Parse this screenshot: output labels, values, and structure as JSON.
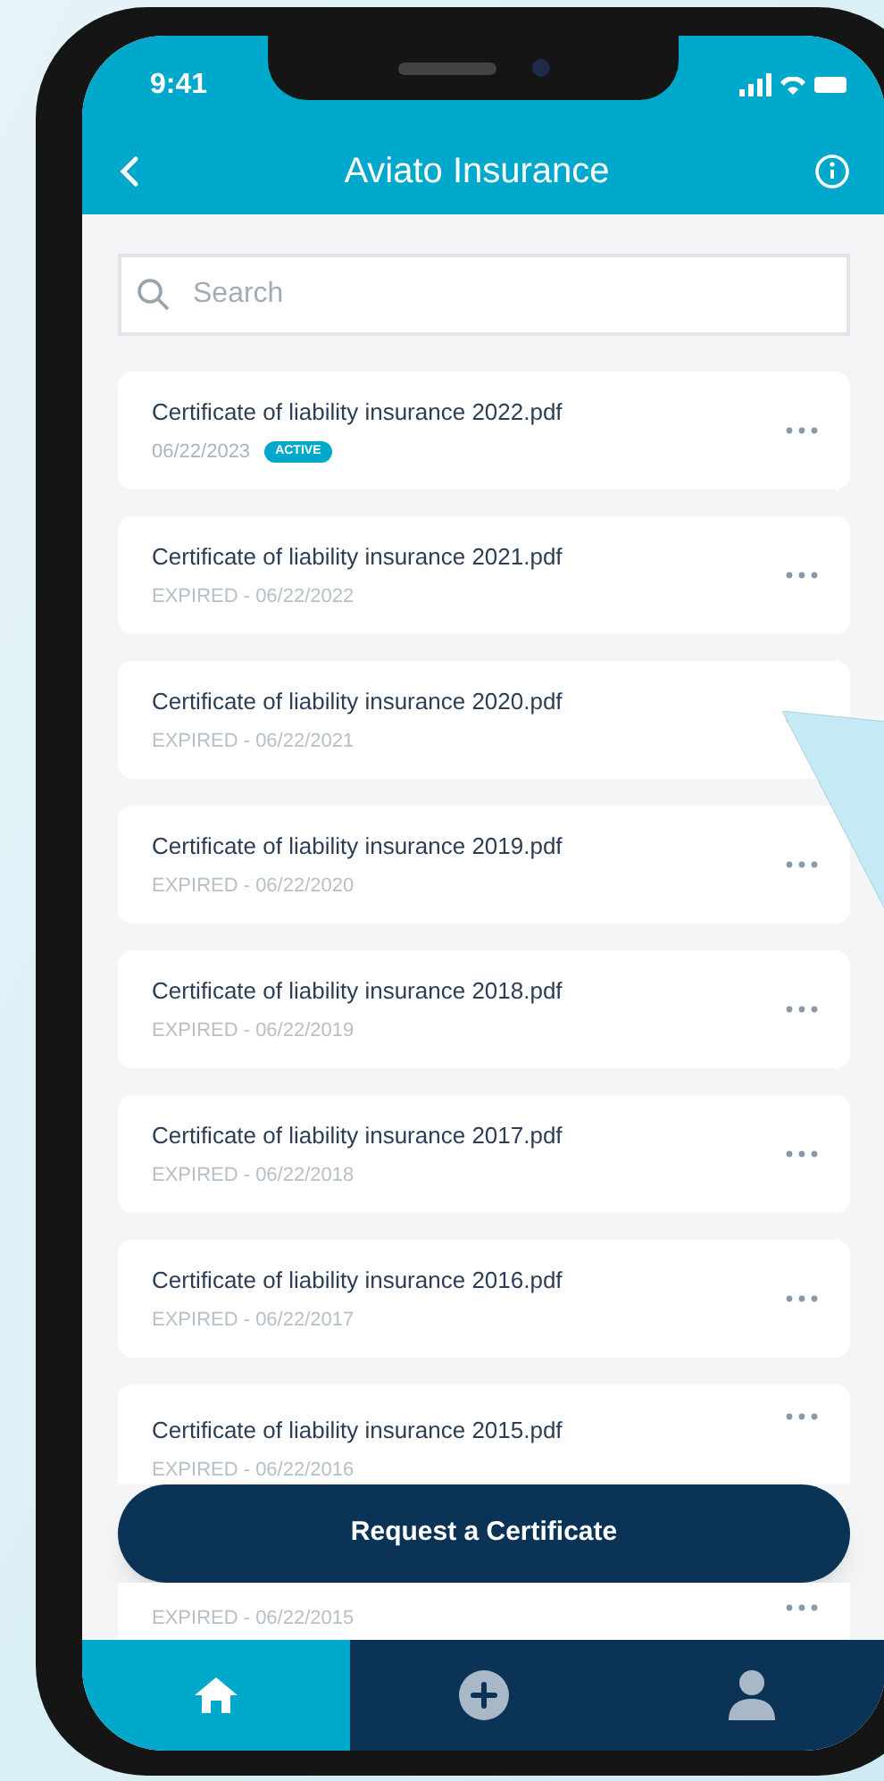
{
  "status_bar": {
    "time": "9:41"
  },
  "header": {
    "title": "Aviato Insurance"
  },
  "search": {
    "placeholder": "Search"
  },
  "documents": [
    {
      "title": "Certificate of liability insurance 2022.pdf",
      "date": "06/22/2023",
      "badge": "ACTIVE",
      "kind": "active"
    },
    {
      "title": "Certificate of liability insurance 2021.pdf",
      "date": "EXPIRED - 06/22/2022",
      "kind": "expired"
    },
    {
      "title": "Certificate of liability insurance 2020.pdf",
      "date": "EXPIRED - 06/22/2021",
      "kind": "expired"
    },
    {
      "title": "Certificate of liability insurance 2019.pdf",
      "date": "EXPIRED - 06/22/2020",
      "kind": "expired"
    },
    {
      "title": "Certificate of liability insurance 2018.pdf",
      "date": "EXPIRED - 06/22/2019",
      "kind": "expired"
    },
    {
      "title": "Certificate of liability insurance 2017.pdf",
      "date": "EXPIRED - 06/22/2018",
      "kind": "expired"
    },
    {
      "title": "Certificate of liability insurance 2016.pdf",
      "date": "EXPIRED - 06/22/2017",
      "kind": "expired"
    },
    {
      "title": "Certificate of liability insurance 2015.pdf",
      "date": "EXPIRED - 06/22/2016",
      "kind": "expired"
    },
    {
      "date": "EXPIRED - 06/22/2015",
      "kind": "expired"
    }
  ],
  "request_button": {
    "label": "Request a Certificate"
  },
  "bottom_nav": [
    {
      "kind": "home",
      "selected": true
    },
    {
      "kind": "add",
      "selected": false
    },
    {
      "kind": "profile",
      "selected": false
    }
  ]
}
